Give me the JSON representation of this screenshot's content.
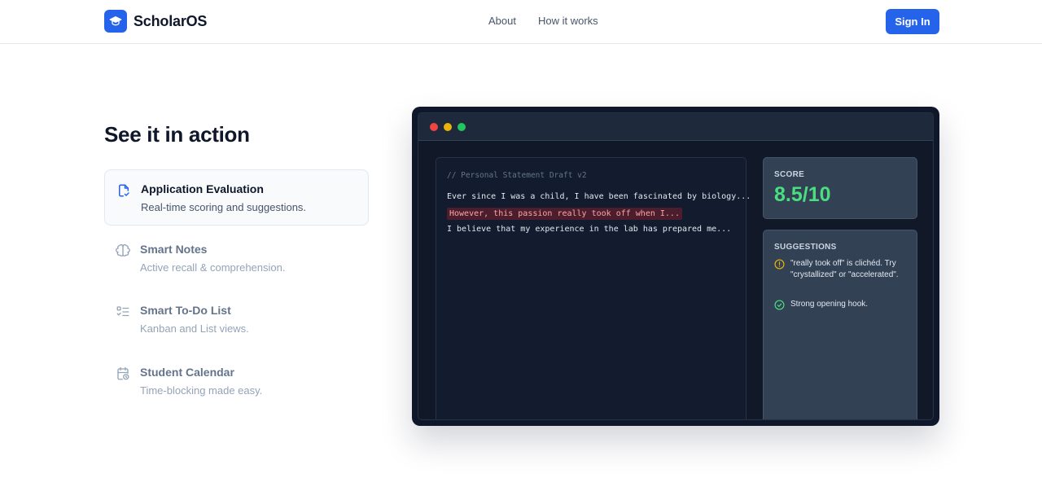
{
  "header": {
    "brand": "ScholarOS",
    "nav": [
      "About",
      "How it works"
    ],
    "signin_label": "Sign In"
  },
  "section": {
    "title": "See it in action",
    "features": [
      {
        "title": "Application Evaluation",
        "desc": "Real-time scoring and suggestions.",
        "icon": "document-check-icon",
        "active": true
      },
      {
        "title": "Smart Notes",
        "desc": "Active recall & comprehension.",
        "icon": "brain-icon",
        "active": false
      },
      {
        "title": "Smart To-Do List",
        "desc": "Kanban and List views.",
        "icon": "checklist-icon",
        "active": false
      },
      {
        "title": "Student Calendar",
        "desc": "Time-blocking made easy.",
        "icon": "calendar-clock-icon",
        "active": false
      }
    ]
  },
  "demo": {
    "editor": {
      "comment": "// Personal Statement Draft v2",
      "lines": [
        "Ever since I was a child, I have been fascinated by biology...",
        "However, this passion really took off when I...",
        "I believe that my experience in the lab has prepared me..."
      ]
    },
    "score": {
      "label": "SCORE",
      "value": "8.5/10"
    },
    "suggestions": {
      "label": "SUGGESTIONS",
      "items": [
        {
          "text": "\"really took off\" is clichéd. Try \"crystallized\" or \"accelerated\".",
          "icon": "warning-circle-icon"
        },
        {
          "text": "Strong opening hook.",
          "icon": "check-circle-icon"
        }
      ]
    }
  },
  "colors": {
    "accent": "#2563eb",
    "score": "#4ade80",
    "warning": "#eab308",
    "success": "#4ade80",
    "highlight_bg": "#4c1d2c"
  }
}
